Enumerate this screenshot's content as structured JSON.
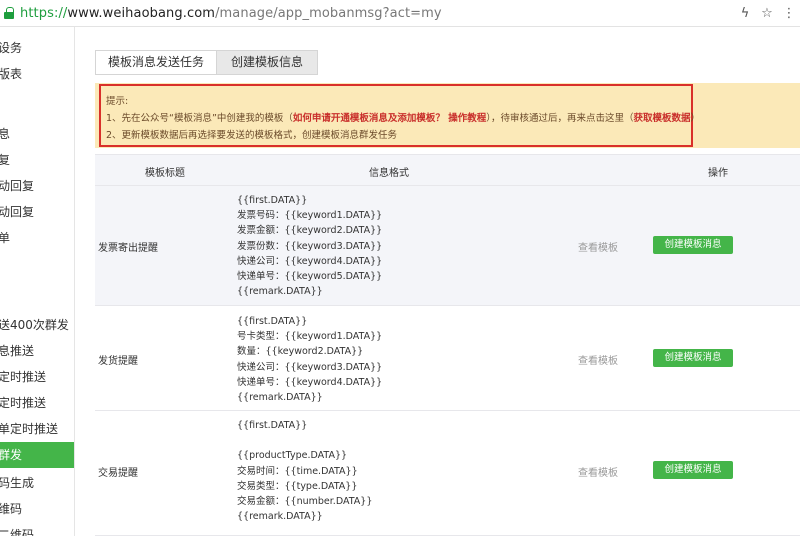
{
  "address_bar": {
    "scheme": "https://",
    "host": "www.weihaobang.com",
    "path": "/manage/app_mobanmsg?act=my",
    "icons": [
      "lightning-icon",
      "star-icon",
      "overflow-icon"
    ]
  },
  "sidebar": {
    "active_color": "#44b549",
    "items": [
      {
        "label": "设务"
      },
      {
        "label": "版表"
      },
      {
        "label": ""
      },
      {
        "label": "息"
      },
      {
        "label": "复"
      },
      {
        "label": "动回复"
      },
      {
        "label": "动回复"
      },
      {
        "label": "单"
      },
      {
        "label": ""
      },
      {
        "label": "送400次群发"
      },
      {
        "label": "息推送"
      },
      {
        "label": "定时推送"
      },
      {
        "label": "定时推送"
      },
      {
        "label": "单定时推送"
      },
      {
        "label": "群发"
      },
      {
        "label": "码生成"
      },
      {
        "label": "维码"
      },
      {
        "label": "二维码"
      }
    ]
  },
  "tabs": [
    {
      "label": "模板消息发送任务"
    },
    {
      "label": "创建模板信息"
    }
  ],
  "notice": {
    "title": "提示:",
    "line1_a": "1、先在公众号“模板消息”中创建我的模板（",
    "line1_link1": "如何申请开通模板消息及添加模板？ 操作教程",
    "line1_b": "），待审核通过后，再来点击这里（",
    "line1_link2": "获取模板数据",
    "line1_c": "）",
    "line2": "2、更新模板数据后再选择要发送的模板格式，创建模板消息群发任务"
  },
  "table": {
    "headers": {
      "title": "模板标题",
      "format": "信息格式",
      "action": "操作"
    },
    "rows": [
      {
        "title": "发票寄出提醒",
        "format": "{{first.DATA}}\n发票号码：{{keyword1.DATA}}\n发票金额：{{keyword2.DATA}}\n发票份数：{{keyword3.DATA}}\n快递公司：{{keyword4.DATA}}\n快递单号：{{keyword5.DATA}}\n{{remark.DATA}}",
        "view": "查看模板",
        "create": "创建模板消息"
      },
      {
        "title": "发货提醒",
        "format": "{{first.DATA}}\n号卡类型：{{keyword1.DATA}}\n数量：{{keyword2.DATA}}\n快递公司：{{keyword3.DATA}}\n快递单号：{{keyword4.DATA}}\n{{remark.DATA}}",
        "view": "查看模板",
        "create": "创建模板消息"
      },
      {
        "title": "交易提醒",
        "format": "{{first.DATA}}\n\n{{productType.DATA}}\n交易时间：{{time.DATA}}\n交易类型：{{type.DATA}}\n交易金额：{{number.DATA}}\n{{remark.DATA}}",
        "view": "查看模板",
        "create": "创建模板消息"
      }
    ]
  }
}
